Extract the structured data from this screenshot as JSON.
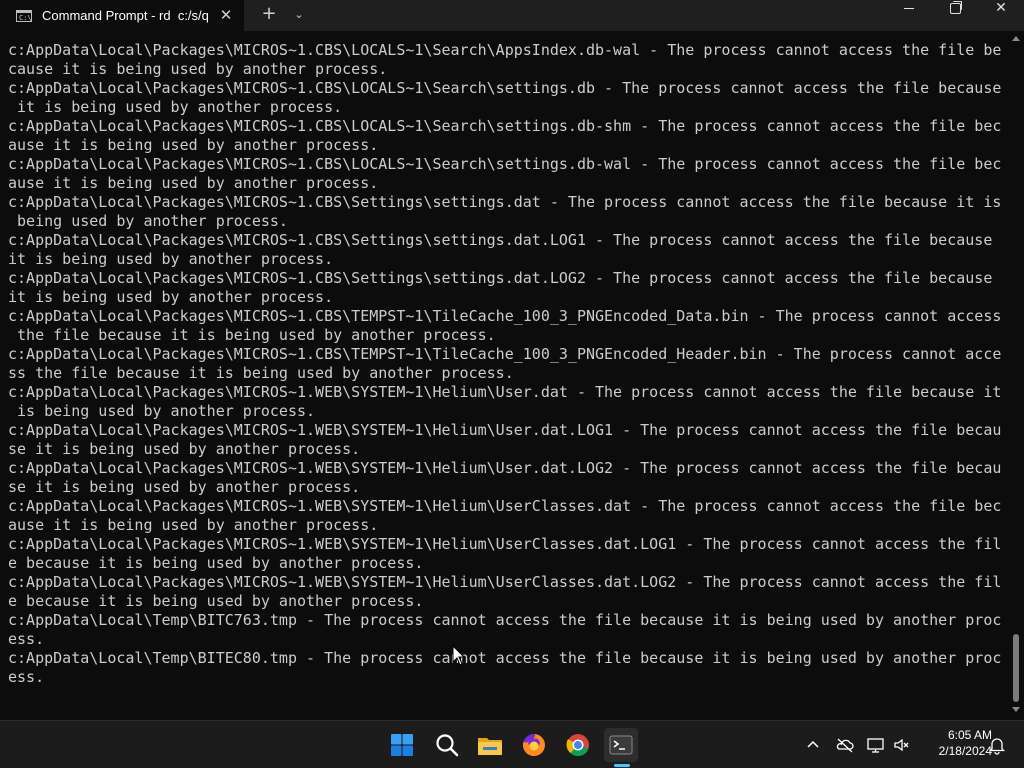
{
  "window": {
    "tab_title": "Command Prompt - rd  c:/s/q",
    "tab_icon_text": "C:\\",
    "close_tab_glyph": "✕",
    "new_tab_glyph": "+",
    "dropdown_glyph": "⌄",
    "close_window_glyph": "✕"
  },
  "terminal": {
    "lines": [
      "c:AppData\\Local\\Packages\\MICROS~1.CBS\\LOCALS~1\\Search\\AppsIndex.db-wal - The process cannot access the file be",
      "cause it is being used by another process.",
      "c:AppData\\Local\\Packages\\MICROS~1.CBS\\LOCALS~1\\Search\\settings.db - The process cannot access the file because",
      " it is being used by another process.",
      "c:AppData\\Local\\Packages\\MICROS~1.CBS\\LOCALS~1\\Search\\settings.db-shm - The process cannot access the file bec",
      "ause it is being used by another process.",
      "c:AppData\\Local\\Packages\\MICROS~1.CBS\\LOCALS~1\\Search\\settings.db-wal - The process cannot access the file bec",
      "ause it is being used by another process.",
      "c:AppData\\Local\\Packages\\MICROS~1.CBS\\Settings\\settings.dat - The process cannot access the file because it is",
      " being used by another process.",
      "c:AppData\\Local\\Packages\\MICROS~1.CBS\\Settings\\settings.dat.LOG1 - The process cannot access the file because",
      "it is being used by another process.",
      "c:AppData\\Local\\Packages\\MICROS~1.CBS\\Settings\\settings.dat.LOG2 - The process cannot access the file because",
      "it is being used by another process.",
      "c:AppData\\Local\\Packages\\MICROS~1.CBS\\TEMPST~1\\TileCache_100_3_PNGEncoded_Data.bin - The process cannot access",
      " the file because it is being used by another process.",
      "c:AppData\\Local\\Packages\\MICROS~1.CBS\\TEMPST~1\\TileCache_100_3_PNGEncoded_Header.bin - The process cannot acce",
      "ss the file because it is being used by another process.",
      "c:AppData\\Local\\Packages\\MICROS~1.WEB\\SYSTEM~1\\Helium\\User.dat - The process cannot access the file because it",
      " is being used by another process.",
      "c:AppData\\Local\\Packages\\MICROS~1.WEB\\SYSTEM~1\\Helium\\User.dat.LOG1 - The process cannot access the file becau",
      "se it is being used by another process.",
      "c:AppData\\Local\\Packages\\MICROS~1.WEB\\SYSTEM~1\\Helium\\User.dat.LOG2 - The process cannot access the file becau",
      "se it is being used by another process.",
      "c:AppData\\Local\\Packages\\MICROS~1.WEB\\SYSTEM~1\\Helium\\UserClasses.dat - The process cannot access the file bec",
      "ause it is being used by another process.",
      "c:AppData\\Local\\Packages\\MICROS~1.WEB\\SYSTEM~1\\Helium\\UserClasses.dat.LOG1 - The process cannot access the fil",
      "e because it is being used by another process.",
      "c:AppData\\Local\\Packages\\MICROS~1.WEB\\SYSTEM~1\\Helium\\UserClasses.dat.LOG2 - The process cannot access the fil",
      "e because it is being used by another process.",
      "c:AppData\\Local\\Temp\\BITC763.tmp - The process cannot access the file because it is being used by another proc",
      "ess.",
      "c:AppData\\Local\\Temp\\BITEC80.tmp - The process cannot access the file because it is being used by another proc",
      "ess."
    ]
  },
  "taskbar": {
    "apps": [
      "start-icon",
      "search-icon",
      "file-explorer-icon",
      "firefox-icon",
      "chrome-icon",
      "terminal-icon"
    ],
    "tray_icons": [
      "chevron-up-icon",
      "onedrive-offline-icon",
      "network-icon",
      "volume-muted-icon",
      "notification-bell-icon"
    ],
    "time": "6:05 AM",
    "date": "2/18/2024"
  },
  "colors": {
    "terminal_bg": "#0c0c0c",
    "terminal_fg": "#cccccc",
    "titlebar_bg": "#1f1f1f",
    "taskbar_bg": "#1c1c1c",
    "accent": "#4cc2ff"
  }
}
